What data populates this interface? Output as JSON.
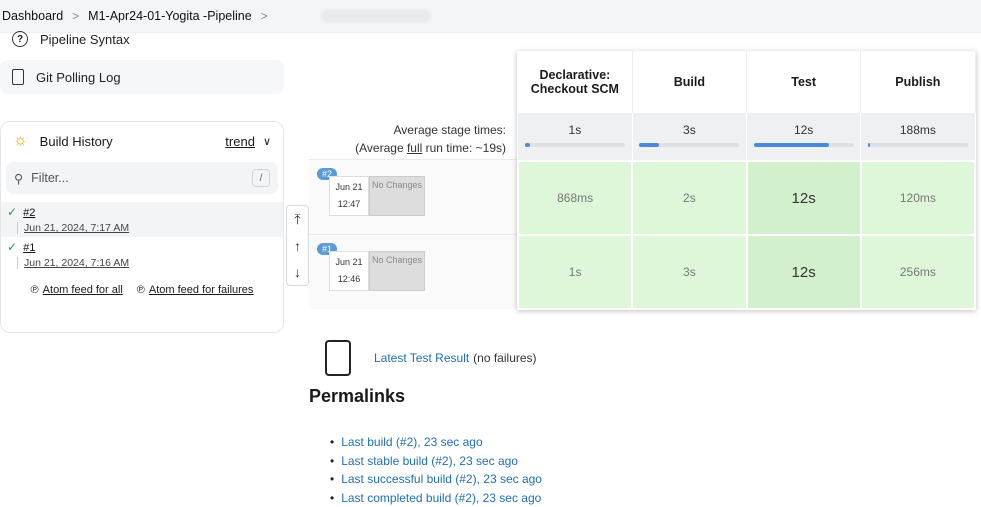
{
  "breadcrumb": {
    "items": [
      "Dashboard",
      "M1-Apr24-01-Yogita -Pipeline"
    ]
  },
  "sidebar": {
    "pipeline_syntax": "Pipeline Syntax",
    "git_polling_log": "Git Polling Log"
  },
  "build_history": {
    "title": "Build History",
    "trend": "trend",
    "filter_placeholder": "Filter...",
    "filter_shortcut": "/",
    "builds": [
      {
        "number": "#2",
        "date": "Jun 21, 2024, 7:17 AM"
      },
      {
        "number": "#1",
        "date": "Jun 21, 2024, 7:16 AM"
      }
    ],
    "feed_all": "Atom feed for all",
    "feed_failures": "Atom feed for failures"
  },
  "stage_view": {
    "avg_label": "Average stage times:",
    "avg_run_prefix": "(Average ",
    "avg_run_full": "full",
    "avg_run_suffix": " run time: ~19s)",
    "stages": [
      {
        "name": "Declarative: Checkout SCM",
        "avg": "1s",
        "avg_fill": 0.05
      },
      {
        "name": "Build",
        "avg": "3s",
        "avg_fill": 0.2
      },
      {
        "name": "Test",
        "avg": "12s",
        "avg_fill": 0.75
      },
      {
        "name": "Publish",
        "avg": "188ms",
        "avg_fill": 0.02
      }
    ],
    "runs": [
      {
        "badge": "#2",
        "date": "Jun 21",
        "time": "12:47",
        "changes": "No Changes",
        "cells": [
          "868ms",
          "2s",
          "12s",
          "120ms"
        ]
      },
      {
        "badge": "#1",
        "date": "Jun 21",
        "time": "12:46",
        "changes": "No Changes",
        "cells": [
          "1s",
          "3s",
          "12s",
          "256ms"
        ]
      }
    ]
  },
  "latest_test": {
    "link": "Latest Test Result",
    "suffix": "(no failures)"
  },
  "permalinks": {
    "title": "Permalinks",
    "items": [
      "Last build (#2), 23 sec ago",
      "Last stable build (#2), 23 sec ago",
      "Last successful build (#2), 23 sec ago",
      "Last completed build (#2), 23 sec ago"
    ]
  }
}
